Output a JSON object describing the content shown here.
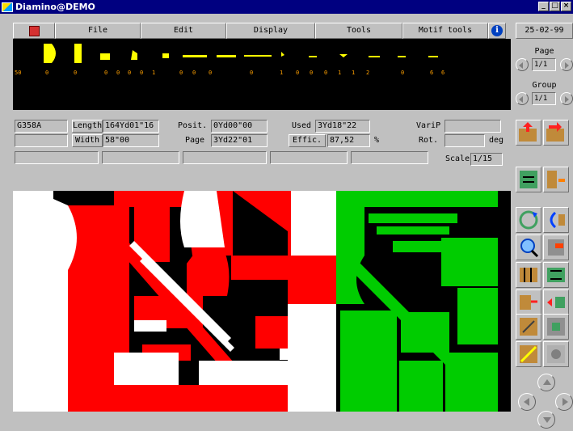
{
  "window": {
    "title": "Diamino@DEMO",
    "minimize": "_",
    "maximize": "□",
    "close": "×"
  },
  "menu": {
    "logo_icon": "app-logo-icon",
    "items": [
      "File",
      "Edit",
      "Display",
      "Tools",
      "Motif tools"
    ],
    "info_glyph": "i"
  },
  "date": "25-02-99",
  "preview": {
    "numbers": [
      "50",
      "0",
      "0",
      "0",
      "0",
      "0",
      "0",
      "1",
      "0",
      "0",
      "0",
      "0",
      "1",
      "0",
      "0",
      "0",
      "1",
      "1",
      "2",
      "0",
      "6",
      "6"
    ],
    "piece_color": "#ffff00"
  },
  "page_panel": {
    "page_label": "Page",
    "page_value": "1/1",
    "group_label": "Group",
    "group_value": "1/1"
  },
  "info": {
    "model_code": "G358A",
    "length_label": "Length",
    "length_value": "164Yd01\"16",
    "width_label": "Width",
    "width_value": "58\"00",
    "posit_label": "Posit.",
    "posit_value": "0Yd00\"00",
    "page_label": "Page",
    "page_value": "3Yd22\"01",
    "used_label": "Used",
    "used_value": "3Yd18\"22",
    "effic_label": "Effic.",
    "effic_value": "87,52",
    "percent": "%",
    "varip_label": "VariP",
    "varip_value": "",
    "rot_label": "Rot.",
    "rot_value": "",
    "deg": "deg",
    "scale_label": "Scale",
    "scale_value": "1/15"
  },
  "colors": {
    "red": "#ff0000",
    "green": "#00cc00",
    "white": "#ffffff",
    "yellow": "#ffff00",
    "black": "#000000",
    "panel": "#c0c0c0"
  },
  "tools": [
    "place-piece-icon",
    "remove-piece-icon",
    "move-piece-icon",
    "align-piece-icon",
    "rotate-piece-icon",
    "flip-piece-icon",
    "zoom-icon",
    "bump-piece-icon",
    "split-icon",
    "spread-icon",
    "fold-icon",
    "swap-icon",
    "cut-piece-icon",
    "block-piece-icon",
    "slice-icon",
    "puzzle-icon"
  ]
}
